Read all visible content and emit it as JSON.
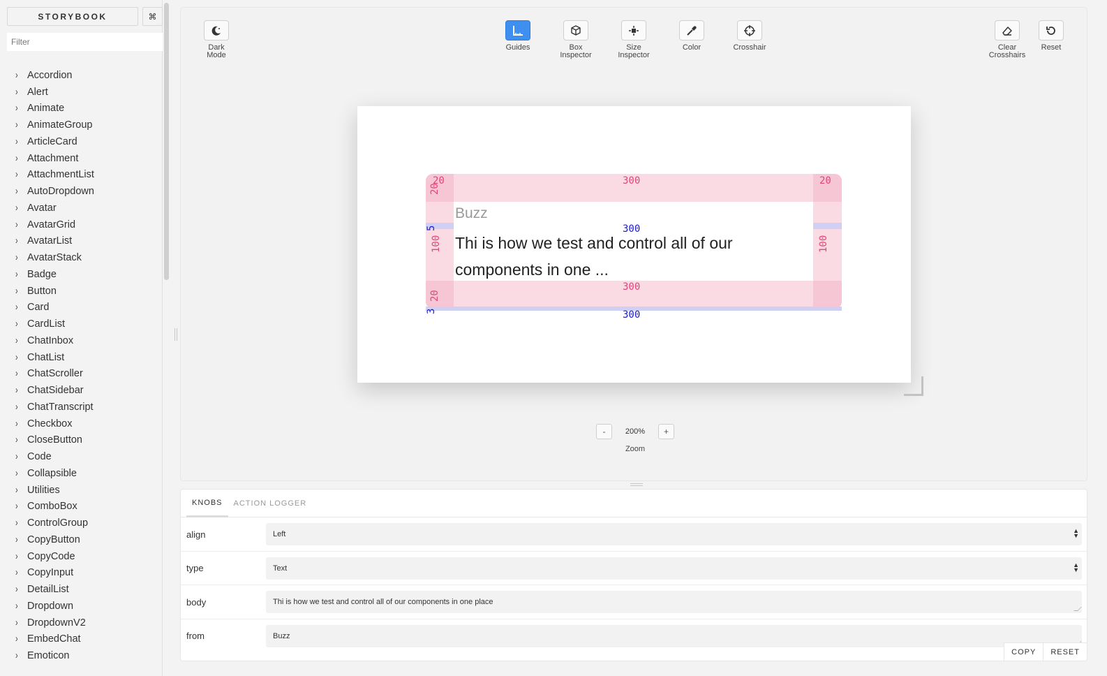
{
  "sidebar": {
    "brand": "STORYBOOK",
    "shortcut": "⌘",
    "filter_placeholder": "Filter",
    "items": [
      "Accordion",
      "Alert",
      "Animate",
      "AnimateGroup",
      "ArticleCard",
      "Attachment",
      "AttachmentList",
      "AutoDropdown",
      "Avatar",
      "AvatarGrid",
      "AvatarList",
      "AvatarStack",
      "Badge",
      "Button",
      "Card",
      "CardList",
      "ChatInbox",
      "ChatList",
      "ChatScroller",
      "ChatSidebar",
      "ChatTranscript",
      "Checkbox",
      "CloseButton",
      "Code",
      "Collapsible",
      "Utilities",
      "ComboBox",
      "ControlGroup",
      "CopyButton",
      "CopyCode",
      "CopyInput",
      "DetailList",
      "Dropdown",
      "DropdownV2",
      "EmbedChat",
      "Emoticon"
    ]
  },
  "toolbar": {
    "dark_mode": "Dark\nMode",
    "guides": "Guides",
    "box_inspector": "Box\nInspector",
    "size_inspector": "Size\nInspector",
    "color": "Color",
    "crosshair": "Crosshair",
    "clear_crosshairs": "Clear\nCrosshairs",
    "reset": "Reset",
    "accent": "#3f8ff0"
  },
  "preview": {
    "from": "Buzz",
    "body_line1": "Thi is how we test and control all of our",
    "body_line2": "components in one ...",
    "guides": {
      "tl": "20",
      "tl_v": "20",
      "top": "300",
      "tr": "20",
      "left_v": "100",
      "right_v": "100",
      "bl_v": "20",
      "bottom": "300",
      "pad_mid": "300",
      "pad_left": "5",
      "pad_bot": "300",
      "pad_bot_left": "3"
    }
  },
  "zoom": {
    "minus": "-",
    "value": "200%",
    "plus": "+",
    "label": "Zoom"
  },
  "panel": {
    "tabs": [
      "KNOBS",
      "ACTION LOGGER"
    ],
    "knobs": [
      {
        "name": "align",
        "value": "Left"
      },
      {
        "name": "type",
        "value": "Text"
      },
      {
        "name": "body",
        "value": "Thi is how we test and control all of our components in one place"
      },
      {
        "name": "from",
        "value": "Buzz"
      }
    ],
    "copy": "COPY",
    "reset": "RESET"
  }
}
